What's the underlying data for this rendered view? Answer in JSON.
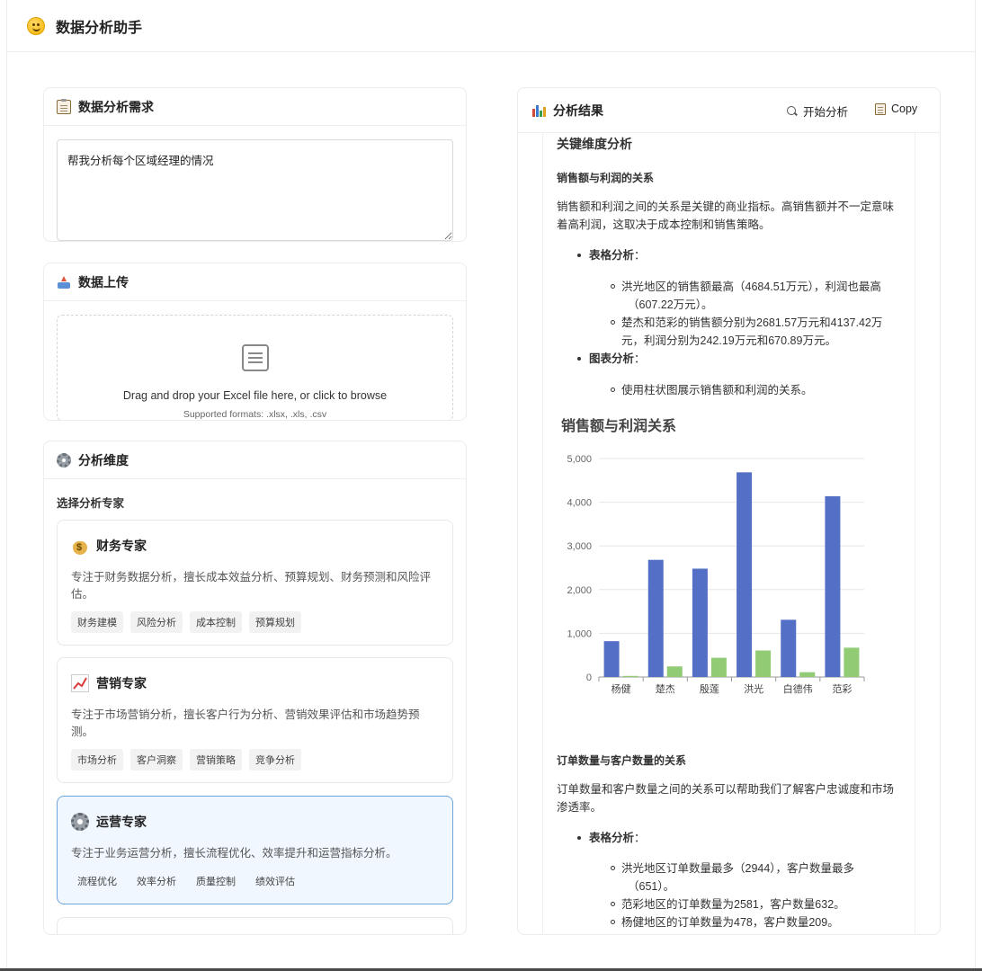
{
  "app": {
    "title": "数据分析助手"
  },
  "requirement": {
    "title": "数据分析需求",
    "value": "帮我分析每个区域经理的情况"
  },
  "upload": {
    "title": "数据上传",
    "main_text": "Drag and drop your Excel file here, or click to browse",
    "formats_text": "Supported formats: .xlsx, .xls, .csv"
  },
  "dimensions": {
    "title": "分析维度",
    "select_label": "选择分析专家",
    "experts": [
      {
        "name": "财务专家",
        "icon": "money-bag-icon",
        "desc": "专注于财务数据分析，擅长成本效益分析、预算规划、财务预测和风险评估。",
        "tags": [
          "财务建模",
          "风险分析",
          "成本控制",
          "预算规划"
        ],
        "selected": false
      },
      {
        "name": "营销专家",
        "icon": "chart-increasing-icon",
        "desc": "专注于市场营销分析，擅长客户行为分析、营销效果评估和市场趋势预测。",
        "tags": [
          "市场分析",
          "客户洞察",
          "营销策略",
          "竞争分析"
        ],
        "selected": false
      },
      {
        "name": "运营专家",
        "icon": "gear-icon",
        "desc": "专注于业务运营分析，擅长流程优化、效率提升和运营指标分析。",
        "tags": [
          "流程优化",
          "效率分析",
          "质量控制",
          "绩效评估"
        ],
        "selected": true
      }
    ]
  },
  "results": {
    "title": "分析结果",
    "start_label": "开始分析",
    "copy_label": "Copy",
    "section_title": "关键维度分析",
    "sub1_title": "销售额与利润的关系",
    "sub1_para_1": "销售额和利润之间的关系是关键的商业指标。高销售额并不一定意味",
    "sub1_para_2": "着高利润，这取决于成本控制和销售策略。",
    "table_label": "表格分析",
    "table_colon": "：",
    "table_items": [
      {
        "l1": "洪光地区的销售额最高（4684.51万元），利润也最高",
        "l2": "（607.22万元）。"
      },
      {
        "l1": "楚杰和范彩的销售额分别为2681.57万元和4137.42万",
        "l2": "元，利润分别为242.19万元和670.89万元。"
      }
    ],
    "chart_label": "图表分析",
    "chart_colon": "：",
    "chart_items": [
      "使用柱状图展示销售额和利润的关系。"
    ],
    "sub2_title": "订单数量与客户数量的关系",
    "sub2_para_1": "订单数量和客户数量之间的关系可以帮助我们了解客户忠诚度和市场",
    "sub2_para_2": "渗透率。",
    "table2_label": "表格分析",
    "table2_colon": "：",
    "table2_items": [
      {
        "l1": "洪光地区订单数量最多（2944），客户数量最多",
        "l2": "（651）。"
      },
      {
        "l1": "范彩地区的订单数量为2581，客户数量632。",
        "l2": ""
      },
      {
        "l1": "杨健地区的订单数量为478，客户数量209。",
        "l2": ""
      }
    ]
  },
  "chart_data": {
    "type": "bar",
    "title": "销售额与利润关系",
    "categories": [
      "杨健",
      "楚杰",
      "殷莲",
      "洪光",
      "白德伟",
      "范彩"
    ],
    "series": [
      {
        "color": "#5470c6",
        "values": [
          820,
          2681.57,
          2480,
          4684.51,
          1310,
          4137.42
        ]
      },
      {
        "color": "#91cc75",
        "values": [
          25,
          242.19,
          440,
          607.22,
          110,
          670.89
        ]
      }
    ],
    "yticks": [
      "0",
      "1,000",
      "2,000",
      "3,000",
      "4,000",
      "5,000"
    ],
    "ylim": [
      0,
      5000
    ],
    "grid": true
  }
}
